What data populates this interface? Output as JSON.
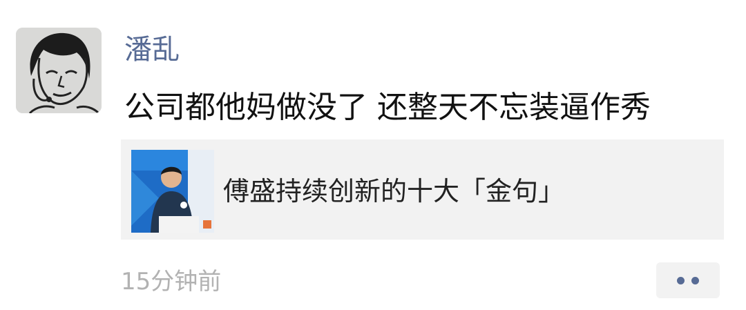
{
  "moment": {
    "username": "潘乱",
    "text": "公司都他妈做没了 还整天不忘装逼作秀",
    "avatar_icon": "sketch-face-avatar",
    "shared_link": {
      "title": "傅盛持续创新的十大「金句」",
      "thumbnail_icon": "speaker-on-stage-thumbnail"
    },
    "timestamp": "15分钟前",
    "more_icon": "two-dots-icon"
  },
  "colors": {
    "username": "#576b95",
    "text": "#111111",
    "card_background": "#f2f2f2",
    "timestamp": "#b2b2b2",
    "dots": "#576b95"
  }
}
